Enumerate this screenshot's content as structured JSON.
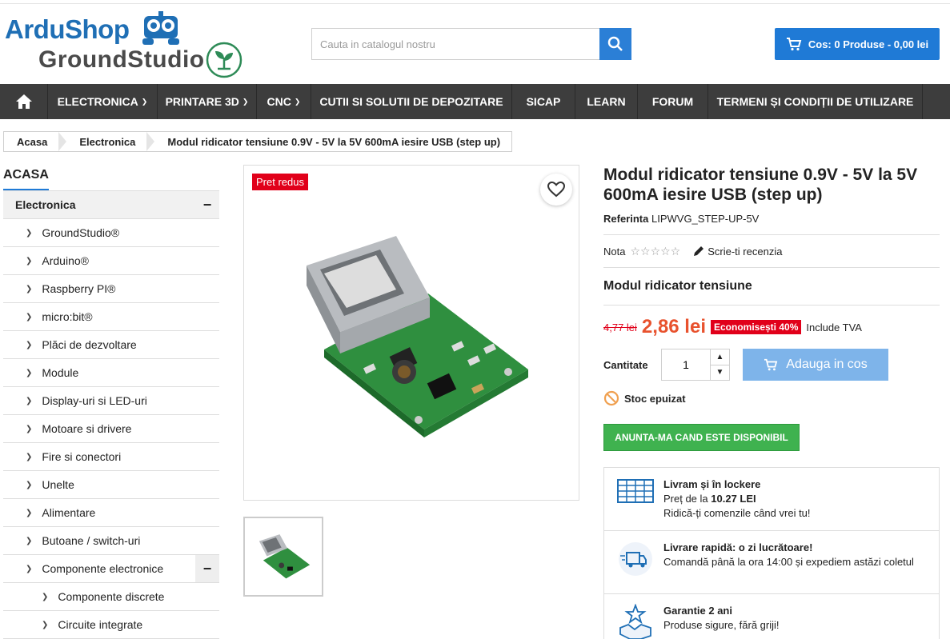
{
  "header": {
    "logo_primary": "ArduShop",
    "logo_secondary": "GroundStudio",
    "search_placeholder": "Cauta in catalogul nostru",
    "cart_label": "Cos: 0 Produse - 0,00 lei"
  },
  "nav": {
    "items": [
      {
        "label": "ELECTRONICA",
        "dropdown": true
      },
      {
        "label": "PRINTARE 3D",
        "dropdown": true
      },
      {
        "label": "CNC",
        "dropdown": true
      },
      {
        "label": "CUTII SI SOLUTII DE DEPOZITARE",
        "dropdown": false
      },
      {
        "label": "SICAP",
        "dropdown": false
      },
      {
        "label": "LEARN",
        "dropdown": false
      },
      {
        "label": "FORUM",
        "dropdown": false
      },
      {
        "label": "TERMENI ȘI CONDIȚII DE UTILIZARE",
        "dropdown": false
      }
    ]
  },
  "breadcrumb": [
    "Acasa",
    "Electronica",
    "Modul ridicator tensiune 0.9V - 5V la 5V 600mA iesire USB (step up)"
  ],
  "sidebar": {
    "title": "ACASA",
    "top": "Electronica",
    "items": [
      "GroundStudio®",
      "Arduino®",
      "Raspberry PI®",
      "micro:bit®",
      "Plăci de dezvoltare",
      "Module",
      "Display-uri si LED-uri",
      "Motoare si drivere",
      "Fire si conectori",
      "Unelte",
      "Alimentare",
      "Butoane / switch-uri",
      "Componente electronice"
    ],
    "subitems": [
      "Componente discrete",
      "Circuite integrate"
    ]
  },
  "product": {
    "badge": "Pret redus",
    "title": "Modul ridicator tensiune 0.9V - 5V la 5V 600mA iesire USB (step up)",
    "reference_label": "Referinta",
    "reference_value": "LIPWVG_STEP-UP-5V",
    "rating_label": "Nota",
    "rating_stars": 0,
    "review_link": "Scrie-ti recenzia",
    "short_desc": "Modul ridicator tensiune",
    "old_price": "4,77 lei",
    "new_price": "2,86 lei",
    "save_label": "Economisești 40%",
    "tax_label": "Include TVA",
    "qty_label": "Cantitate",
    "qty_value": "1",
    "add_to_cart": "Adauga in cos",
    "stock_label": "Stoc epuizat",
    "notify_button": "ANUNTA-MA CAND ESTE DISPONIBIL"
  },
  "info_box": [
    {
      "title": "Livram și în lockere",
      "line1_prefix": "Preț de la ",
      "line1_bold": "10.27 LEI",
      "line2": "Ridică-ți comenzile când vrei tu!"
    },
    {
      "title": "Livrare rapidă: o zi lucrătoare!",
      "line1_prefix": "Comandă până la ora 14:00 și expediem astăzi coletul",
      "line1_bold": "",
      "line2": ""
    },
    {
      "title": "Garantie 2 ani",
      "line1_prefix": "Produse sigure, fără griji!",
      "line1_bold": "",
      "line2": ""
    }
  ],
  "colors": {
    "accent": "#1f7ad6",
    "sale": "#e1001a",
    "price": "#e8522e",
    "notify": "#3fb24f",
    "nav": "#3d3d3d"
  }
}
